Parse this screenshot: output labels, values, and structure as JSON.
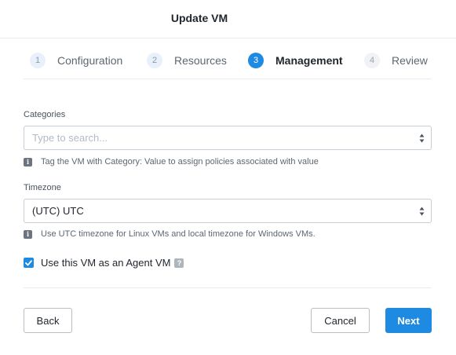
{
  "dialog": {
    "title": "Update VM"
  },
  "steps": [
    {
      "num": "1",
      "label": "Configuration"
    },
    {
      "num": "2",
      "label": "Resources"
    },
    {
      "num": "3",
      "label": "Management"
    },
    {
      "num": "4",
      "label": "Review"
    }
  ],
  "categories": {
    "label": "Categories",
    "placeholder": "Type to search...",
    "hint": "Tag the VM with Category: Value to assign policies associated with value"
  },
  "timezone": {
    "label": "Timezone",
    "value": "(UTC) UTC",
    "hint": "Use UTC timezone for Linux VMs and local timezone for Windows VMs."
  },
  "agent_vm": {
    "label": "Use this VM as an Agent VM",
    "checked": true,
    "help_glyph": "?"
  },
  "info_glyph": "i",
  "buttons": {
    "back": "Back",
    "cancel": "Cancel",
    "next": "Next"
  },
  "colors": {
    "primary": "#1f8ae1",
    "border": "#c7cdd4",
    "text": "#22272e"
  }
}
